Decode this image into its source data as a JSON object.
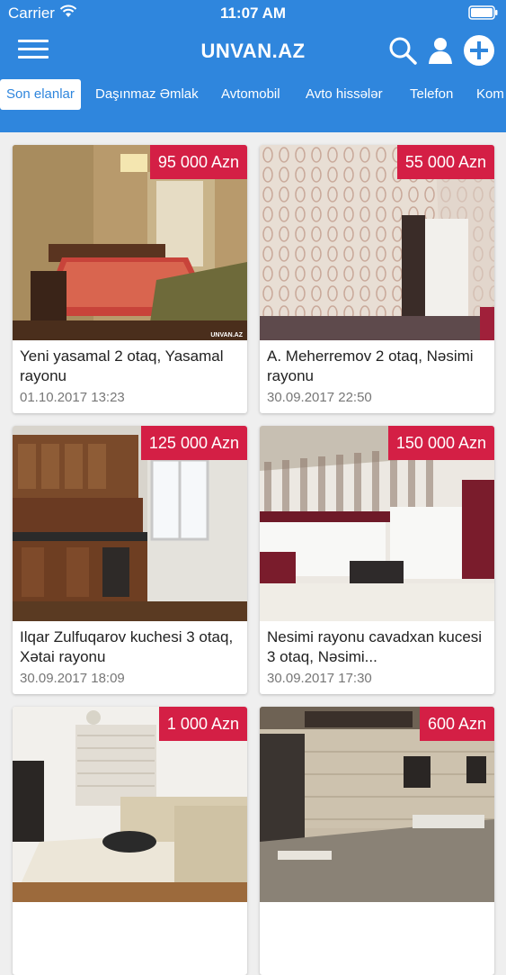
{
  "status_bar": {
    "carrier": "Carrier",
    "time": "11:07 AM"
  },
  "header": {
    "title": "UNVAN.AZ",
    "icons": [
      "menu-icon",
      "search-icon",
      "user-icon",
      "add-icon"
    ]
  },
  "tabs": [
    {
      "label": "Son elanlar",
      "active": true
    },
    {
      "label": "Daşınmaz Əmlak"
    },
    {
      "label": "Avtomobil"
    },
    {
      "label": "Avto hissələr"
    },
    {
      "label": "Telefon"
    },
    {
      "label": "Kom"
    }
  ],
  "listings": [
    {
      "price": "95 000 Azn",
      "title": "Yeni yasamal 2 otaq, Yasamal rayonu",
      "date": "01.10.2017 13:23",
      "watermark": "UNVAN.AZ"
    },
    {
      "price": "55 000 Azn",
      "title": "A. Meherremov 2 otaq, Nəsimi rayonu",
      "date": "30.09.2017 22:50"
    },
    {
      "price": "125 000 Azn",
      "title": "Ilqar Zulfuqarov kuchesi 3 otaq, Xətai rayonu",
      "date": "30.09.2017 18:09"
    },
    {
      "price": "150 000 Azn",
      "title": "Nesimi rayonu cavadxan kucesi 3 otaq, Nəsimi...",
      "date": "30.09.2017 17:30"
    },
    {
      "price": "1 000 Azn",
      "title": "",
      "date": ""
    },
    {
      "price": "600 Azn",
      "title": "",
      "date": ""
    }
  ],
  "colors": {
    "primary": "#2f86dd",
    "price_badge": "#d41f45",
    "background": "#efefef"
  }
}
